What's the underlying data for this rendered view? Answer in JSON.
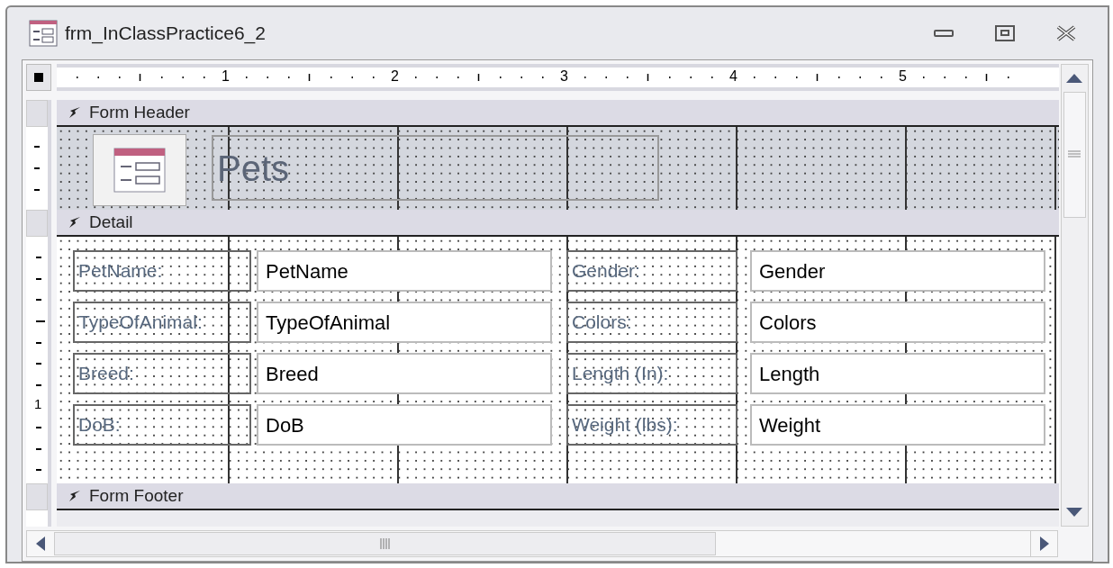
{
  "window": {
    "title": "frm_InClassPractice6_2"
  },
  "ruler": {
    "marks": [
      "1",
      "2",
      "3",
      "4",
      "5"
    ]
  },
  "vertical_ruler": {
    "marks": [
      "1"
    ]
  },
  "sections": [
    {
      "kind": "header",
      "title": "Form Header",
      "heading": "Pets"
    },
    {
      "kind": "detail",
      "title": "Detail",
      "rows": [
        {
          "left": {
            "label": "PetName:",
            "control": "PetName"
          },
          "right": {
            "label": "Gender:",
            "control": "Gender"
          }
        },
        {
          "left": {
            "label": "TypeOfAnimal:",
            "control": "TypeOfAnimal"
          },
          "right": {
            "label": "Colors:",
            "control": "Colors"
          }
        },
        {
          "left": {
            "label": "Breed:",
            "control": "Breed"
          },
          "right": {
            "label": "Length (In):",
            "control": "Length"
          }
        },
        {
          "left": {
            "label": "DoB:",
            "control": "DoB"
          },
          "right": {
            "label": "Weight (lbs):",
            "control": "Weight"
          }
        }
      ]
    },
    {
      "kind": "footer",
      "title": "Form Footer"
    }
  ]
}
